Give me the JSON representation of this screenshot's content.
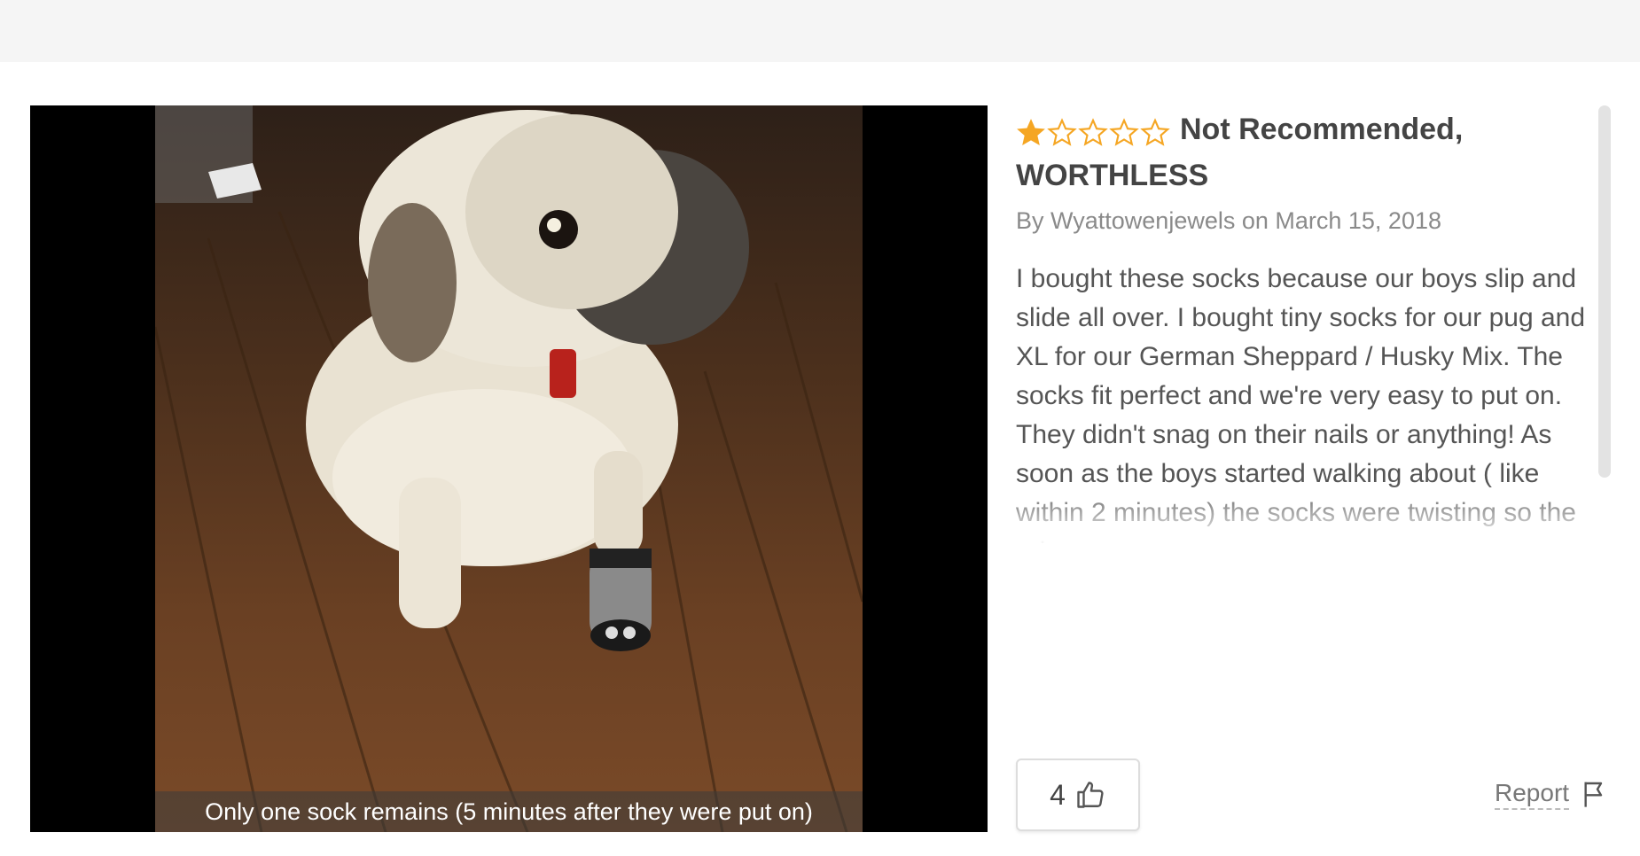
{
  "review": {
    "rating": 1,
    "max_rating": 5,
    "title": "Not Recommended, WORTHLESS",
    "byline": "By Wyattowenjewels on March 15, 2018",
    "body": "I bought these socks because our boys slip and slide all over. I bought tiny socks for our pug and XL for our German Sheppard / Husky Mix. The socks fit perfect and we're very easy to put on. They didn't snag on their nails or anything! As soon as the boys started walking about ( like within 2 minutes) the socks were twisting so the grippers were on",
    "helpful_count": "4",
    "report_label": "Report"
  },
  "photo": {
    "caption": "Only one sock remains (5 minutes after they were put on)",
    "subject": "pug wearing one sock on wood floor"
  },
  "icons": {
    "star_filled": "star-filled-icon",
    "star_empty": "star-empty-icon",
    "thumbs_up": "thumbs-up-icon",
    "flag": "flag-icon"
  },
  "colors": {
    "star": "#f5a623",
    "title": "#444444",
    "byline": "#8a8a8a",
    "body": "#555555"
  }
}
